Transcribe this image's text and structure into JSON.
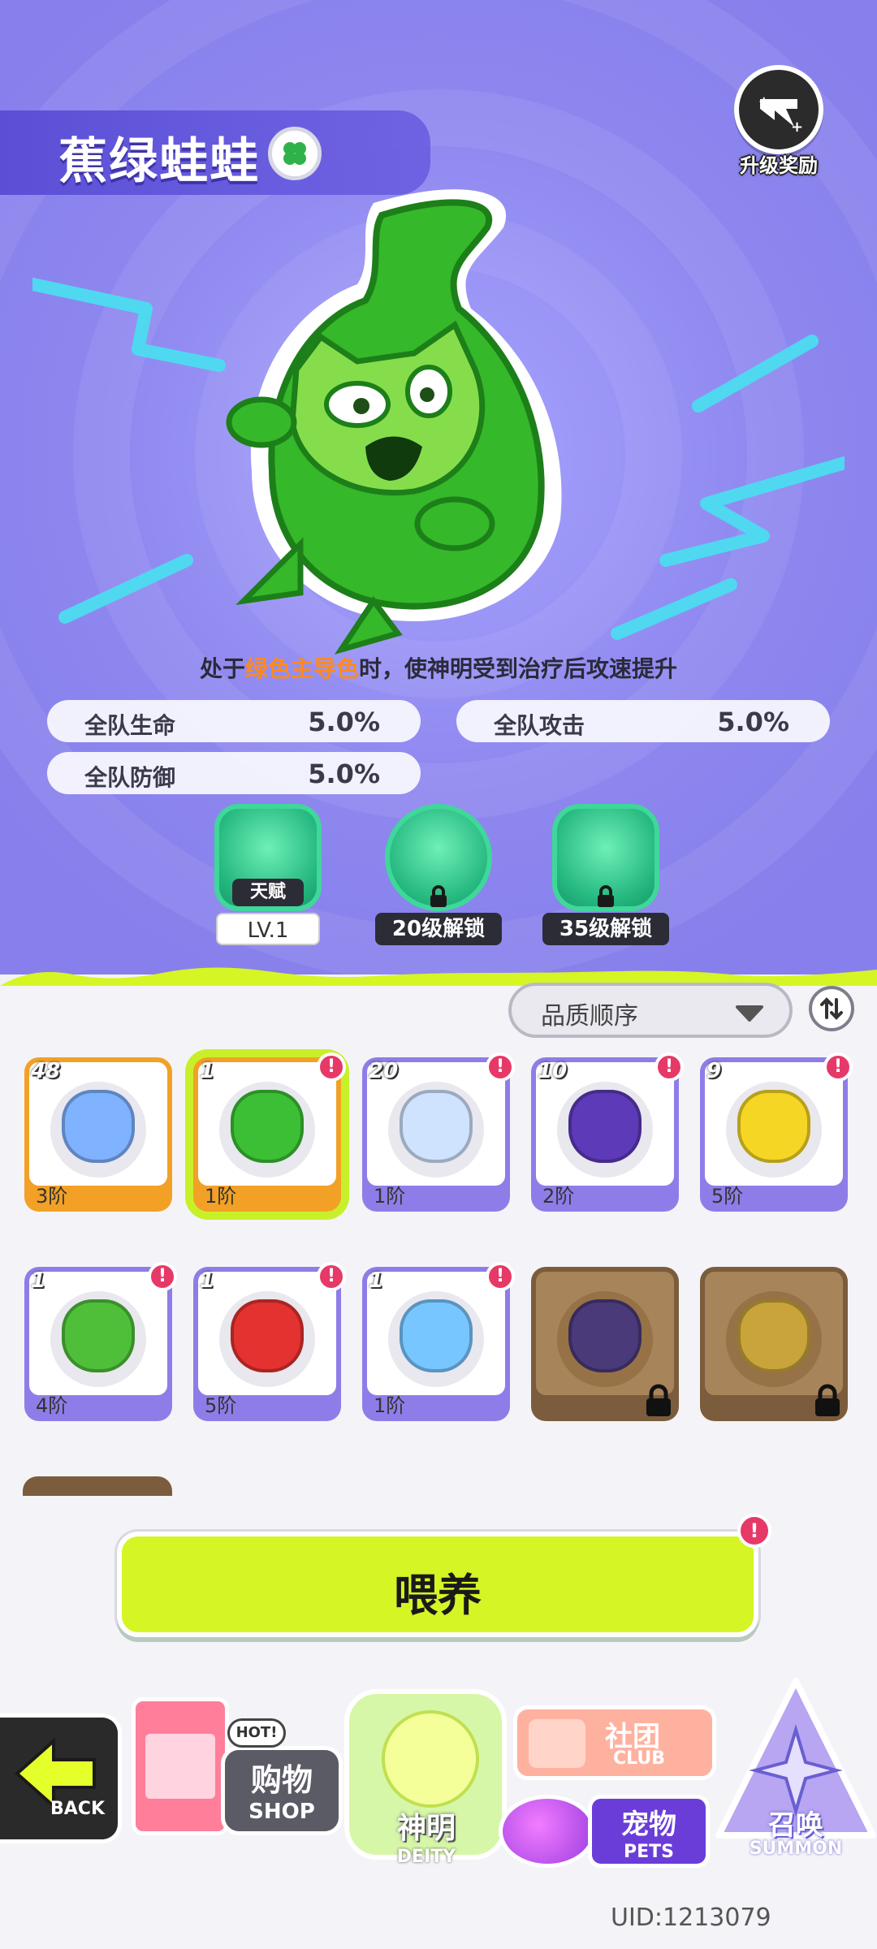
{
  "pet": {
    "name": "蕉绿蛙蛙",
    "element_icon": "clover-icon",
    "description_prefix": "处于",
    "description_highlight": "绿色主导色",
    "description_suffix": "时，使神明受到治疗后攻速提升",
    "stats": [
      {
        "label": "全队生命",
        "value": "5.0%"
      },
      {
        "label": "全队攻击",
        "value": "5.0%"
      },
      {
        "label": "全队防御",
        "value": "5.0%"
      }
    ]
  },
  "upgrade_reward": {
    "label": "升级奖励",
    "icon": "lightning-plus-icon"
  },
  "skills": [
    {
      "tag": "天赋",
      "sub": "LV.1",
      "locked": false
    },
    {
      "tag": "",
      "sub": "20级解锁",
      "locked": true
    },
    {
      "tag": "",
      "sub": "35级解锁",
      "locked": true
    }
  ],
  "sort": {
    "label": "品质顺序"
  },
  "pets": [
    {
      "level": "48",
      "grade": "3阶",
      "notice": false,
      "icon": "blue-bunny-icon"
    },
    {
      "level": "1",
      "grade": "1阶",
      "notice": true,
      "icon": "green-frog-icon",
      "selected": true
    },
    {
      "level": "20",
      "grade": "1阶",
      "notice": true,
      "icon": "cloud-cat-icon"
    },
    {
      "level": "10",
      "grade": "2阶",
      "notice": true,
      "icon": "purple-bat-cat-icon"
    },
    {
      "level": "9",
      "grade": "5阶",
      "notice": true,
      "icon": "yellow-bolt-icon"
    },
    {
      "level": "1",
      "grade": "4阶",
      "notice": true,
      "icon": "leaf-sprout-icon"
    },
    {
      "level": "1",
      "grade": "5阶",
      "notice": true,
      "icon": "red-fish-icon"
    },
    {
      "level": "1",
      "grade": "1阶",
      "notice": true,
      "icon": "blue-bird-icon"
    },
    {
      "level": "",
      "grade": "",
      "notice": false,
      "icon": "grape-icon",
      "locked": true
    },
    {
      "level": "",
      "grade": "",
      "notice": false,
      "icon": "pufferfish-icon",
      "locked": true
    }
  ],
  "feed_button": {
    "label": "喂养",
    "notice": "!"
  },
  "notice_mark": "!",
  "nav": {
    "back": "BACK",
    "shop": {
      "zh": "购物",
      "en": "SHOP",
      "hot": "HOT!"
    },
    "deity": {
      "zh": "神明",
      "en": "DEITY"
    },
    "club": {
      "zh": "社团",
      "en": "CLUB"
    },
    "pets": {
      "zh": "宠物",
      "en": "PETS"
    },
    "summon": {
      "zh": "召唤",
      "en": "SUMMON"
    }
  },
  "uid": "UID:1213079",
  "colors": {
    "hero_bg": "#8e87ef",
    "accent_lime": "#d6f524",
    "notice_red": "#e63968",
    "card_purple": "#8e7de8",
    "card_orange": "#f2a126"
  }
}
